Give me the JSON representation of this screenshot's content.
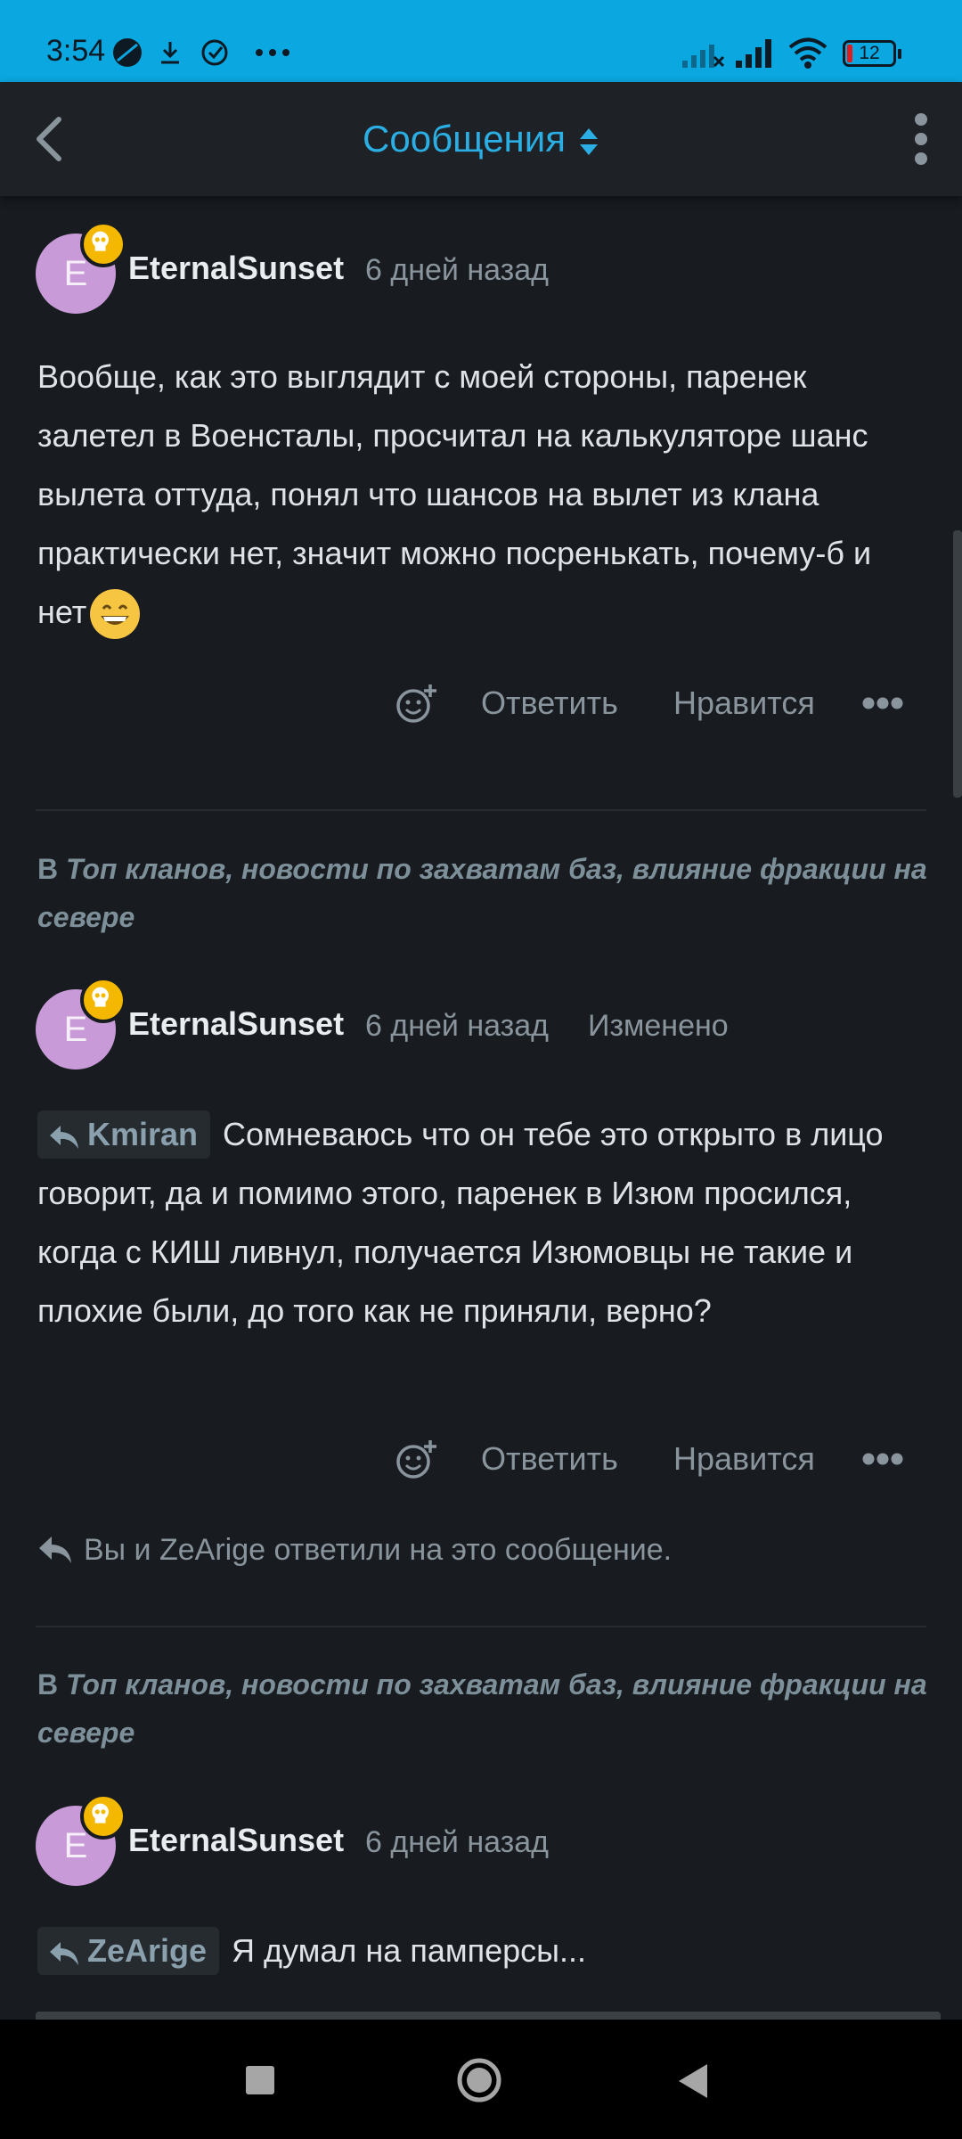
{
  "status_bar": {
    "time": "3:54",
    "battery": "12"
  },
  "app_bar": {
    "title": "Сообщения"
  },
  "messages": [
    {
      "avatar_letter": "E",
      "author": "EternalSunset",
      "time": "6 дней назад",
      "text": "Вообще, как это выглядит с моей стороны, паренек залетел в Военсталы, просчитал на калькуляторе шанс вылета оттуда, понял что шансов на вылет из клана практически нет, значит можно посренькать, почему-б и нет"
    },
    {
      "topic_prefix": "В",
      "topic": "Топ кланов, новости по захватам баз, влияние фракции на севере",
      "avatar_letter": "E",
      "author": "EternalSunset",
      "time": "6 дней назад",
      "edited": "Изменено",
      "quote": "Kmiran",
      "text": "Сомневаюсь что он тебе это открыто в лицо говорит, да и помимо этого, паренек в Изюм просился, когда с КИШ ливнул, получается Изюмовцы не такие и плохие были, до того как не приняли, верно?",
      "replied_note": "Вы и ZeArige ответили на это сообщение."
    },
    {
      "topic_prefix": "В",
      "topic": "Топ кланов, новости по захватам баз, влияние фракции на севере",
      "avatar_letter": "E",
      "author": "EternalSunset",
      "time": "6 дней назад",
      "quote": "ZeArige",
      "text": "Я думал на памперсы..."
    }
  ],
  "actions": {
    "reply": "Ответить",
    "like": "Нравится"
  },
  "colors": {
    "accent": "#2aaee3",
    "status_bar": "#0aa7e0",
    "background": "#181c20",
    "avatar": "#c89ad8",
    "badge": "#f4b800"
  },
  "icons": [
    "back-arrow-icon",
    "sort-icon",
    "more-vert-icon",
    "add-reaction-icon",
    "more-horiz-icon",
    "reply-icon",
    "skull-badge-icon",
    "grinning-emoji-icon"
  ]
}
